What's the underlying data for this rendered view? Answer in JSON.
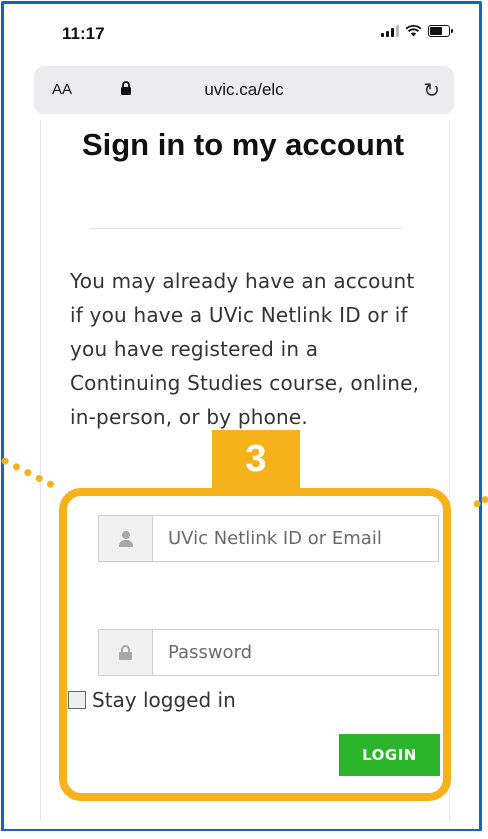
{
  "status_bar": {
    "time": "11:17"
  },
  "browser": {
    "text_size_label": "AA",
    "url": "uvic.ca/elc"
  },
  "page": {
    "title": "Sign in to my account",
    "intro": "You may already have an account if you have a UVic Netlink ID or if you have registered in a Continuing Studies course, online, in-person, or by phone.",
    "username_placeholder": "UVic Netlink ID or Email",
    "password_placeholder": "Password",
    "stay_logged_in_label": "Stay logged in",
    "login_label": "LOGIN"
  },
  "annotation": {
    "step_number": "3",
    "highlight_color": "#f5b21a"
  },
  "colors": {
    "frame": "#1565b8",
    "login_button": "#2ab52a"
  }
}
